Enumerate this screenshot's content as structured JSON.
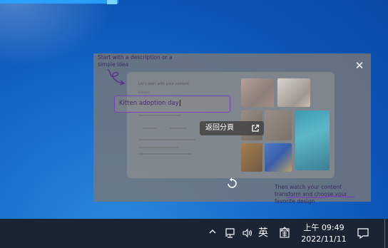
{
  "overlay": {
    "close_glyph": "✕",
    "hint_top": "Start with a description or a simple idea",
    "hint_bottom": "Then watch your content transform and choose your favorite design",
    "card_title": "Let's start with your content",
    "card_sub": "Subject",
    "topic_value": "Kitten adoption day",
    "return_label": "返回分頁",
    "return_icon": "open-in-new-icon",
    "replay_icon": "replay-icon"
  },
  "taskbar": {
    "ime_label": "英",
    "time": "上午 09:49",
    "date": "2022/11/11"
  },
  "colors": {
    "overlay": "#787878",
    "accent_purple": "#7a3fb4",
    "taskbar": "#1b2433",
    "desktop_blue": "#1a6fce"
  }
}
